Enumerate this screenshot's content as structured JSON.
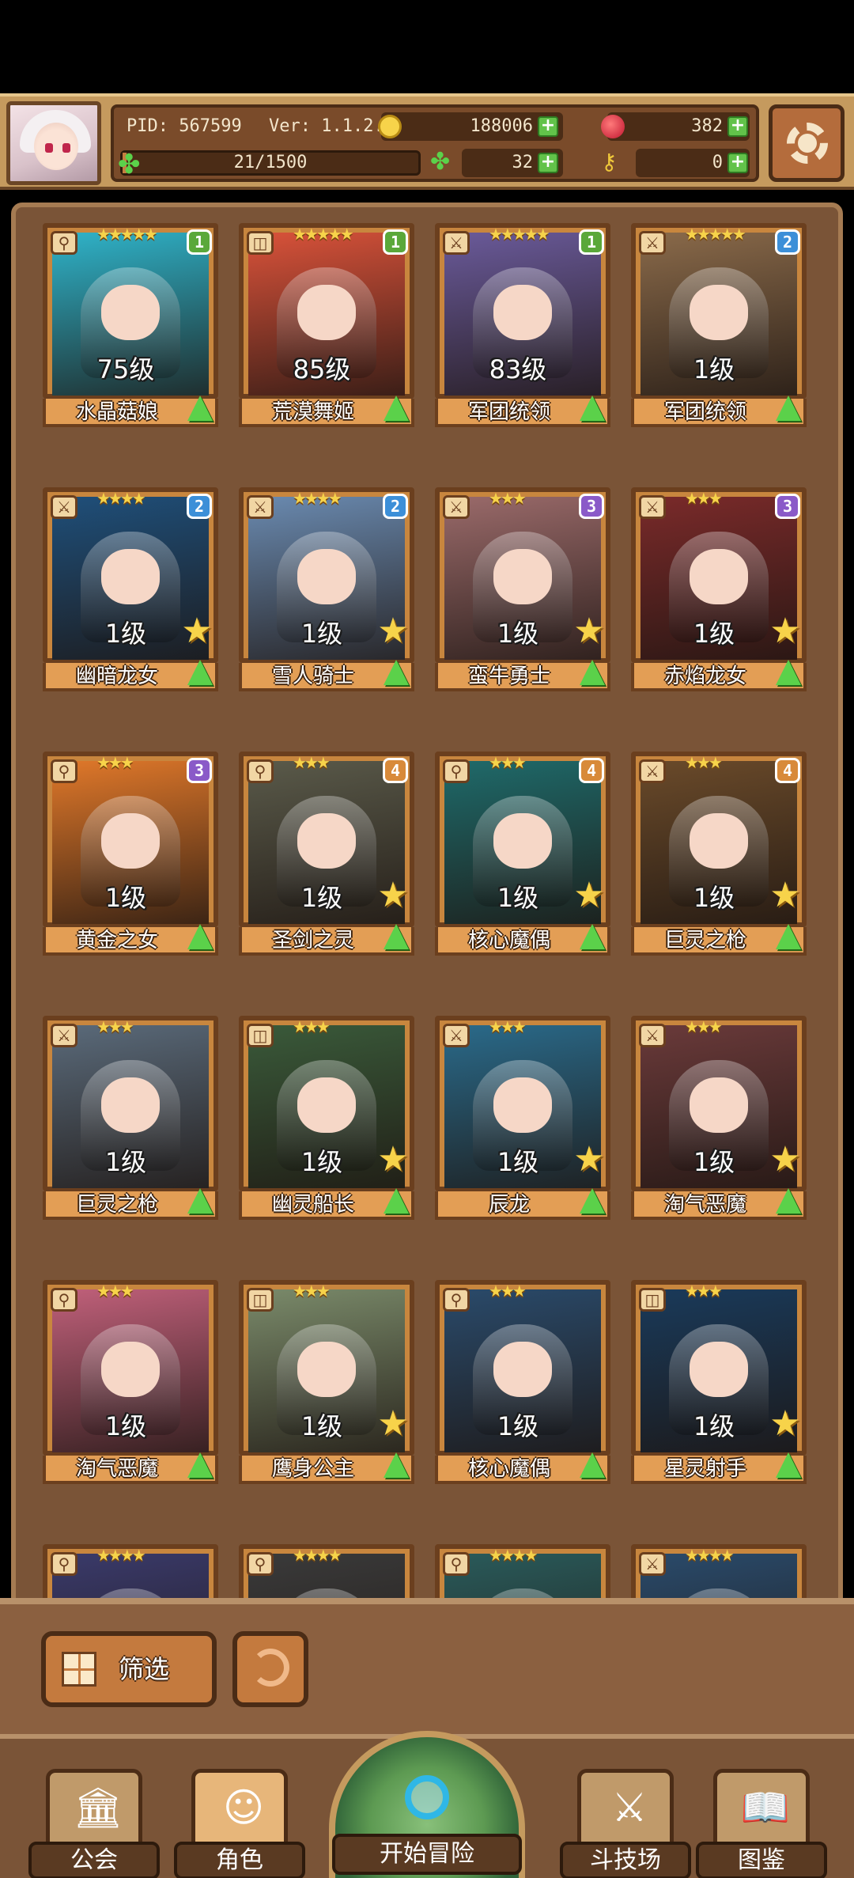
{
  "header": {
    "pid": "PID: 567599",
    "version": "Ver: 1.1.2.0",
    "gold": "188006",
    "gems": "382",
    "exp": "21/1500",
    "exp_progress": 0.014,
    "clovers": "32",
    "keys": "0"
  },
  "cards": [
    {
      "name": "水晶菇娘",
      "level": "75级",
      "stars": "★★★★★",
      "rank": "1",
      "rank_color": "#5aa83a",
      "art": "#2fb3c9",
      "weapon": "⚲",
      "star_badge": false
    },
    {
      "name": "荒漠舞姬",
      "level": "85级",
      "stars": "★★★★★",
      "rank": "1",
      "rank_color": "#5aa83a",
      "art": "#d9523a",
      "weapon": "◫",
      "star_badge": false
    },
    {
      "name": "军团统领",
      "level": "83级",
      "stars": "★★★★★",
      "rank": "1",
      "rank_color": "#5aa83a",
      "art": "#6a5a9a",
      "weapon": "⚔",
      "star_badge": false
    },
    {
      "name": "军团统领",
      "level": "1级",
      "stars": "★★★★★",
      "rank": "2",
      "rank_color": "#3c8fd8",
      "art": "#8a6a4a",
      "weapon": "⚔",
      "star_badge": false
    },
    {
      "name": "幽暗龙女",
      "level": "1级",
      "stars": "★★★★",
      "rank": "2",
      "rank_color": "#3c8fd8",
      "art": "#1f4f7a",
      "weapon": "⚔",
      "star_badge": true
    },
    {
      "name": "雪人骑士",
      "level": "1级",
      "stars": "★★★★",
      "rank": "2",
      "rank_color": "#3c8fd8",
      "art": "#6a8ab0",
      "weapon": "⚔",
      "star_badge": true
    },
    {
      "name": "蛮牛勇士",
      "level": "1级",
      "stars": "★★★",
      "rank": "3",
      "rank_color": "#8a5ac8",
      "art": "#9a6a6a",
      "weapon": "⚔",
      "star_badge": true
    },
    {
      "name": "赤焰龙女",
      "level": "1级",
      "stars": "★★★",
      "rank": "3",
      "rank_color": "#8a5ac8",
      "art": "#7a2a2a",
      "weapon": "⚔",
      "star_badge": true
    },
    {
      "name": "黄金之女",
      "level": "1级",
      "stars": "★★★",
      "rank": "3",
      "rank_color": "#8a5ac8",
      "art": "#e0782a",
      "weapon": "⚲",
      "star_badge": false
    },
    {
      "name": "圣剑之灵",
      "level": "1级",
      "stars": "★★★",
      "rank": "4",
      "rank_color": "#d88a3a",
      "art": "#5a5a4a",
      "weapon": "⚲",
      "star_badge": true
    },
    {
      "name": "核心魔偶",
      "level": "1级",
      "stars": "★★★",
      "rank": "4",
      "rank_color": "#d88a3a",
      "art": "#1f6a6a",
      "weapon": "⚲",
      "star_badge": true
    },
    {
      "name": "巨灵之枪",
      "level": "1级",
      "stars": "★★★",
      "rank": "4",
      "rank_color": "#d88a3a",
      "art": "#6a4a2a",
      "weapon": "⚔",
      "star_badge": true
    },
    {
      "name": "巨灵之枪",
      "level": "1级",
      "stars": "★★★",
      "rank": "",
      "rank_color": "",
      "art": "#5a6a7a",
      "weapon": "⚔",
      "star_badge": false
    },
    {
      "name": "幽灵船长",
      "level": "1级",
      "stars": "★★★",
      "rank": "",
      "rank_color": "",
      "art": "#3a5a3a",
      "weapon": "◫",
      "star_badge": true
    },
    {
      "name": "辰龙",
      "level": "1级",
      "stars": "★★★",
      "rank": "",
      "rank_color": "",
      "art": "#2a6a8a",
      "weapon": "⚔",
      "star_badge": true
    },
    {
      "name": "淘气恶魔",
      "level": "1级",
      "stars": "★★★",
      "rank": "",
      "rank_color": "",
      "art": "#6a3a3a",
      "weapon": "⚔",
      "star_badge": true
    },
    {
      "name": "淘气恶魔",
      "level": "1级",
      "stars": "★★★",
      "rank": "",
      "rank_color": "",
      "art": "#c0607a",
      "weapon": "⚲",
      "star_badge": false
    },
    {
      "name": "鹰身公主",
      "level": "1级",
      "stars": "★★★",
      "rank": "",
      "rank_color": "",
      "art": "#7a8a6a",
      "weapon": "◫",
      "star_badge": true
    },
    {
      "name": "核心魔偶",
      "level": "1级",
      "stars": "★★★",
      "rank": "",
      "rank_color": "",
      "art": "#2a4a6a",
      "weapon": "⚲",
      "star_badge": false
    },
    {
      "name": "星灵射手",
      "level": "1级",
      "stars": "★★★",
      "rank": "",
      "rank_color": "",
      "art": "#1a3a5a",
      "weapon": "◫",
      "star_badge": true
    },
    {
      "name": "",
      "level": "",
      "stars": "★★★★",
      "rank": "",
      "rank_color": "",
      "art": "#3a3a6a",
      "weapon": "⚲",
      "star_badge": false
    },
    {
      "name": "",
      "level": "",
      "stars": "★★★★",
      "rank": "",
      "rank_color": "",
      "art": "#3a3a3a",
      "weapon": "⚲",
      "star_badge": false
    },
    {
      "name": "",
      "level": "",
      "stars": "★★★★",
      "rank": "",
      "rank_color": "",
      "art": "#2a5a5a",
      "weapon": "⚲",
      "star_badge": false
    },
    {
      "name": "",
      "level": "",
      "stars": "★★★★",
      "rank": "",
      "rank_color": "",
      "art": "#2a4a6a",
      "weapon": "⚔",
      "star_badge": false
    }
  ],
  "filter": {
    "label": "筛选"
  },
  "nav": {
    "guild": "公会",
    "character": "角色",
    "adventure": "开始冒险",
    "arena": "斗技场",
    "codex": "图鉴"
  },
  "icons": {
    "settings": "gear-icon",
    "gold": "coin-icon",
    "gems": "gem-icon",
    "clover": "clover-icon",
    "key": "key-icon",
    "filter": "grid-icon",
    "refresh": "refresh-icon"
  }
}
